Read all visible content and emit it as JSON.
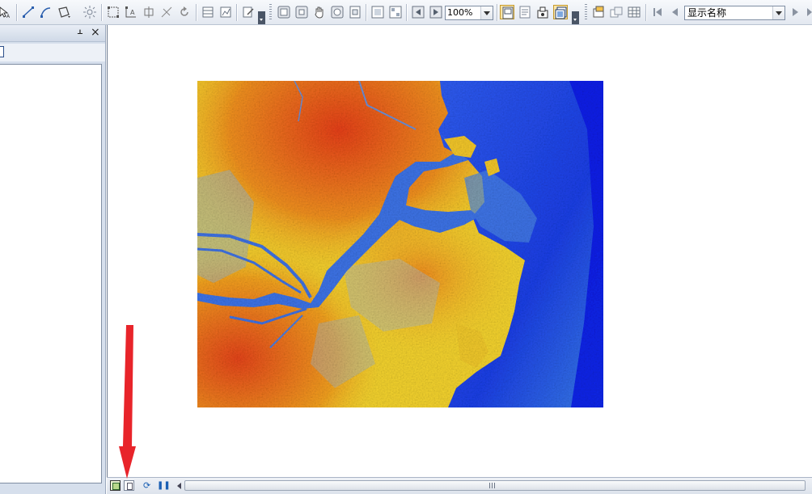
{
  "toolbar": {
    "zoom_value": "100%",
    "label_field": "显示名称",
    "icons": [
      "select-arrow-icon",
      "line-icon",
      "curve-icon",
      "polygon-icon",
      "sun-icon",
      "extent-icon",
      "move-icon",
      "split-icon",
      "rotate-icon",
      "table-icon",
      "graph-icon",
      "editor-icon",
      "zoom-in-fixed-icon",
      "zoom-out-fixed-icon",
      "pan-icon",
      "full-extent-icon",
      "zoom-page-icon",
      "zoom-whole-icon",
      "zoom-100-icon",
      "back-icon",
      "forward-icon",
      "layout-icon",
      "draft-icon",
      "focus-frame-icon",
      "data-frame-icon",
      "layer-properties-icon",
      "copy-layer-icon",
      "attribute-table-icon",
      "first-page-icon",
      "prev-page-icon",
      "next-page-icon"
    ]
  },
  "toc_panel": {
    "pin_glyph": "ᚆ",
    "close_glyph": "×"
  },
  "statusbar": {
    "refresh_glyph": "⟳",
    "pause_glyph": "❚❚"
  },
  "colors": {
    "arrow": "#e8242a",
    "water_deep": "#0a1fe0",
    "water_shallow": "#3f79e6",
    "land_high": "#e8461a",
    "land_mid": "#f4a11c",
    "land_low": "#f6e234"
  }
}
